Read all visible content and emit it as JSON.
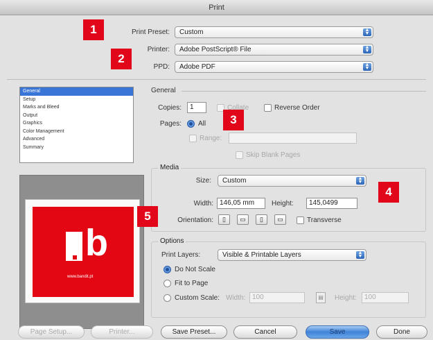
{
  "window": {
    "title": "Print"
  },
  "top": {
    "print_preset_label": "Print Preset:",
    "print_preset_value": "Custom",
    "printer_label": "Printer:",
    "printer_value": "Adobe PostScript® File",
    "ppd_label": "PPD:",
    "ppd_value": "Adobe PDF"
  },
  "categories": [
    "General",
    "Setup",
    "Marks and Bleed",
    "Output",
    "Graphics",
    "Color Management",
    "Advanced",
    "Summary"
  ],
  "selected_category": "General",
  "general": {
    "title": "General",
    "copies_label": "Copies:",
    "copies_value": "1",
    "collate_label": "Collate",
    "reverse_order_label": "Reverse Order",
    "pages_label": "Pages:",
    "all_label": "All",
    "range_label": "Range:",
    "skip_blank_label": "Skip Blank Pages"
  },
  "media": {
    "title": "Media",
    "size_label": "Size:",
    "size_value": "Custom",
    "width_label": "Width:",
    "width_value": "146,05 mm",
    "height_label": "Height:",
    "height_value": "145,0499",
    "orientation_label": "Orientation:",
    "transverse_label": "Transverse"
  },
  "options": {
    "title": "Options",
    "print_layers_label": "Print Layers:",
    "print_layers_value": "Visible & Printable Layers",
    "do_not_scale_label": "Do Not Scale",
    "fit_to_page_label": "Fit to Page",
    "custom_scale_label": "Custom Scale:",
    "scale_width_label": "Width:",
    "scale_width_value": "100",
    "scale_height_label": "Height:",
    "scale_height_value": "100"
  },
  "preview": {
    "logo_letter": "b",
    "logo_url": "www.bandit.pt"
  },
  "buttons": {
    "page_setup": "Page Setup...",
    "printer": "Printer...",
    "save_preset": "Save Preset...",
    "cancel": "Cancel",
    "save": "Save",
    "done": "Done"
  },
  "callouts": [
    "1",
    "2",
    "3",
    "4",
    "5"
  ],
  "colors": {
    "callout_red": "#e1061a",
    "selection_blue": "#3875d7",
    "logo_red": "#e30613"
  }
}
